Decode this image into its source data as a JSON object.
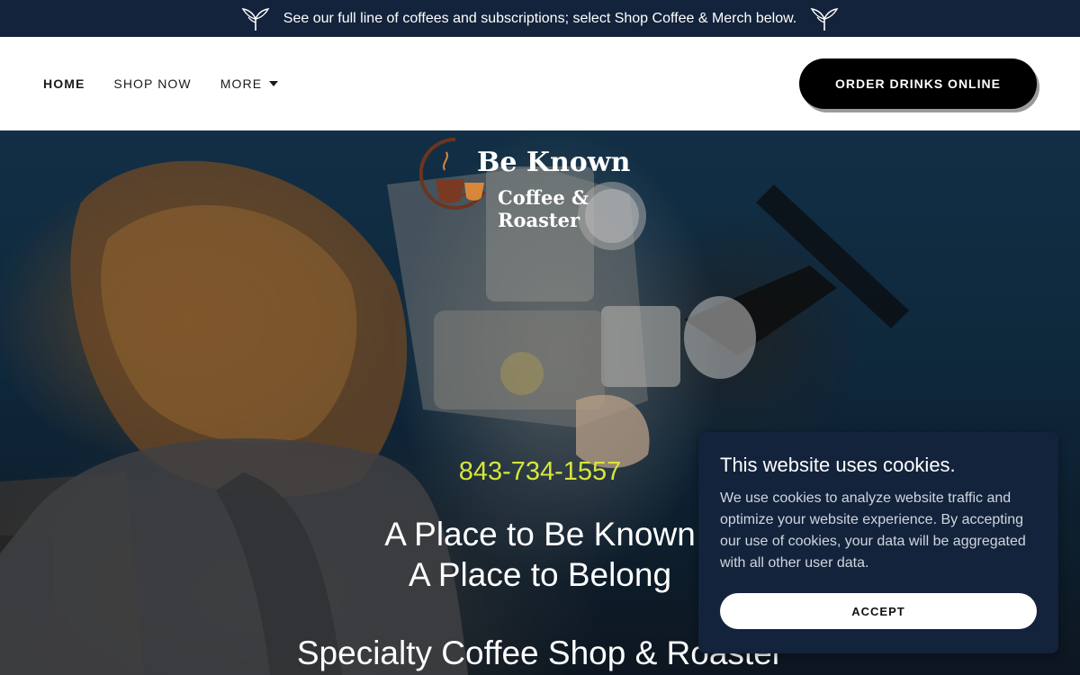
{
  "announcement": {
    "text": "See our full line of coffees and subscriptions; select Shop Coffee & Merch below.",
    "left_icon": "leaf-sprout-icon",
    "right_icon": "leaf-sprout-icon"
  },
  "nav": {
    "items": [
      {
        "label": "HOME",
        "active": true
      },
      {
        "label": "SHOP NOW",
        "active": false
      },
      {
        "label": "MORE",
        "active": false,
        "has_dropdown": true
      }
    ],
    "cta_label": "ORDER DRINKS ONLINE"
  },
  "logo": {
    "line1": "Be Known",
    "line2": "Coffee & Roaster",
    "icon": "coffee-cup-icon"
  },
  "hero": {
    "phone": "843-734-1557",
    "tagline_line1": "A Place to Be Known",
    "tagline_line2": "A Place to Belong",
    "subtitle": "Specialty Coffee Shop & Roaster"
  },
  "cookie_banner": {
    "title": "This website uses cookies.",
    "text": "We use cookies to analyze website traffic and optimize your website experience. By accepting our use of cookies, your data will be aggregated with all other user data.",
    "accept_label": "ACCEPT"
  },
  "colors": {
    "announcement_bg": "#13233b",
    "phone": "#d7e63a",
    "cta_bg": "#000000",
    "cookie_bg": "#13233b"
  }
}
